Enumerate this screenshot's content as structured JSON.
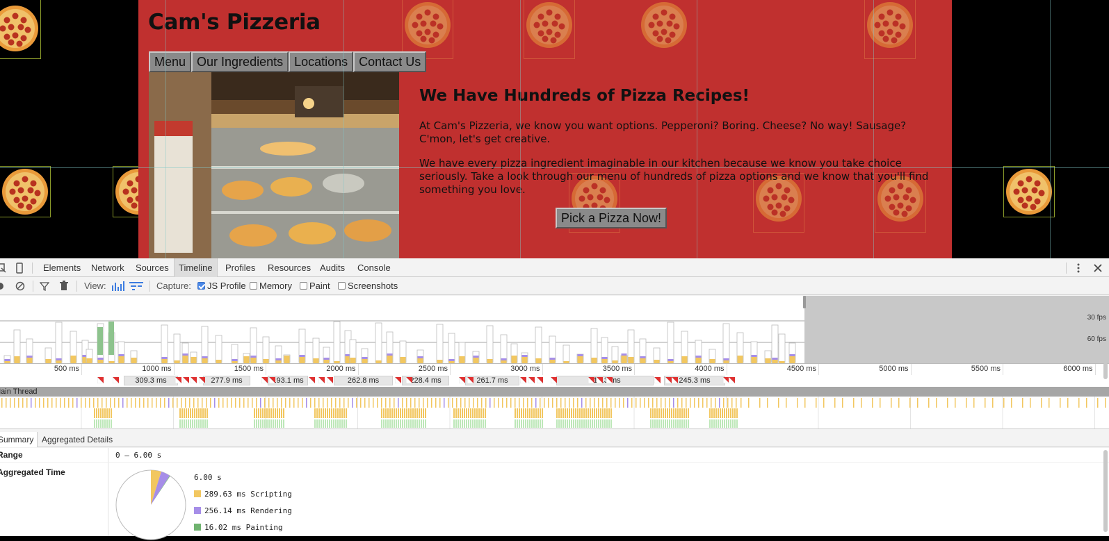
{
  "site": {
    "title": "Cam's Pizzeria",
    "nav": [
      "Menu",
      "Our Ingredients",
      "Locations",
      "Contact Us"
    ],
    "headline": "We Have Hundreds of Pizza Recipes!",
    "paragraph1": "At Cam's Pizzeria, we know you want options. Pepperoni? Boring. Cheese? No way! Sausage? C'mon, let's get creative.",
    "paragraph2": "We have every pizza ingredient imaginable in our kitchen because we know you take choice seriously. Take a look through our menu of hundreds of pizza options and we know that you'll find something you love.",
    "cta": "Pick a Pizza Now!",
    "colors": {
      "page_bg": "#c0302f",
      "outer_bg": "#000000",
      "button_bg": "#8a8a8a"
    }
  },
  "devtools": {
    "tabs": [
      "Elements",
      "Network",
      "Sources",
      "Timeline",
      "Profiles",
      "Resources",
      "Audits",
      "Console"
    ],
    "active_tab": "Timeline",
    "toolbar": {
      "view_label": "View:",
      "capture_label": "Capture:",
      "checkboxes": [
        {
          "label": "JS Profile",
          "checked": true
        },
        {
          "label": "Memory",
          "checked": false
        },
        {
          "label": "Paint",
          "checked": false
        },
        {
          "label": "Screenshots",
          "checked": false
        }
      ]
    },
    "fps_labels": [
      "30 fps",
      "60 fps"
    ],
    "ruler_ticks": [
      "500 ms",
      "1000 ms",
      "1500 ms",
      "2000 ms",
      "2500 ms",
      "3000 ms",
      "3500 ms",
      "4000 ms",
      "4500 ms",
      "5000 ms",
      "5500 ms",
      "6000 ms"
    ],
    "frame_durations": [
      "309.3 ms",
      "277.9 ms",
      "193.1 ms",
      "262.8 ms",
      "228.4 ms",
      "261.7 ms",
      "210.3 ms",
      "245.3 ms"
    ],
    "thread_label": "Main Thread",
    "detail_tabs": [
      "Summary",
      "Aggregated Details"
    ],
    "summary": {
      "range_label": "Range",
      "range_value": "0 – 6.00 s",
      "aggregated_label": "Aggregated Time",
      "total": "6.00 s",
      "legend": [
        {
          "label": "289.63 ms Scripting",
          "color": "#f2c760"
        },
        {
          "label": "256.14 ms Rendering",
          "color": "#a68ee8"
        },
        {
          "label": "16.02 ms Painting",
          "color": "#6fb36f"
        }
      ]
    }
  }
}
